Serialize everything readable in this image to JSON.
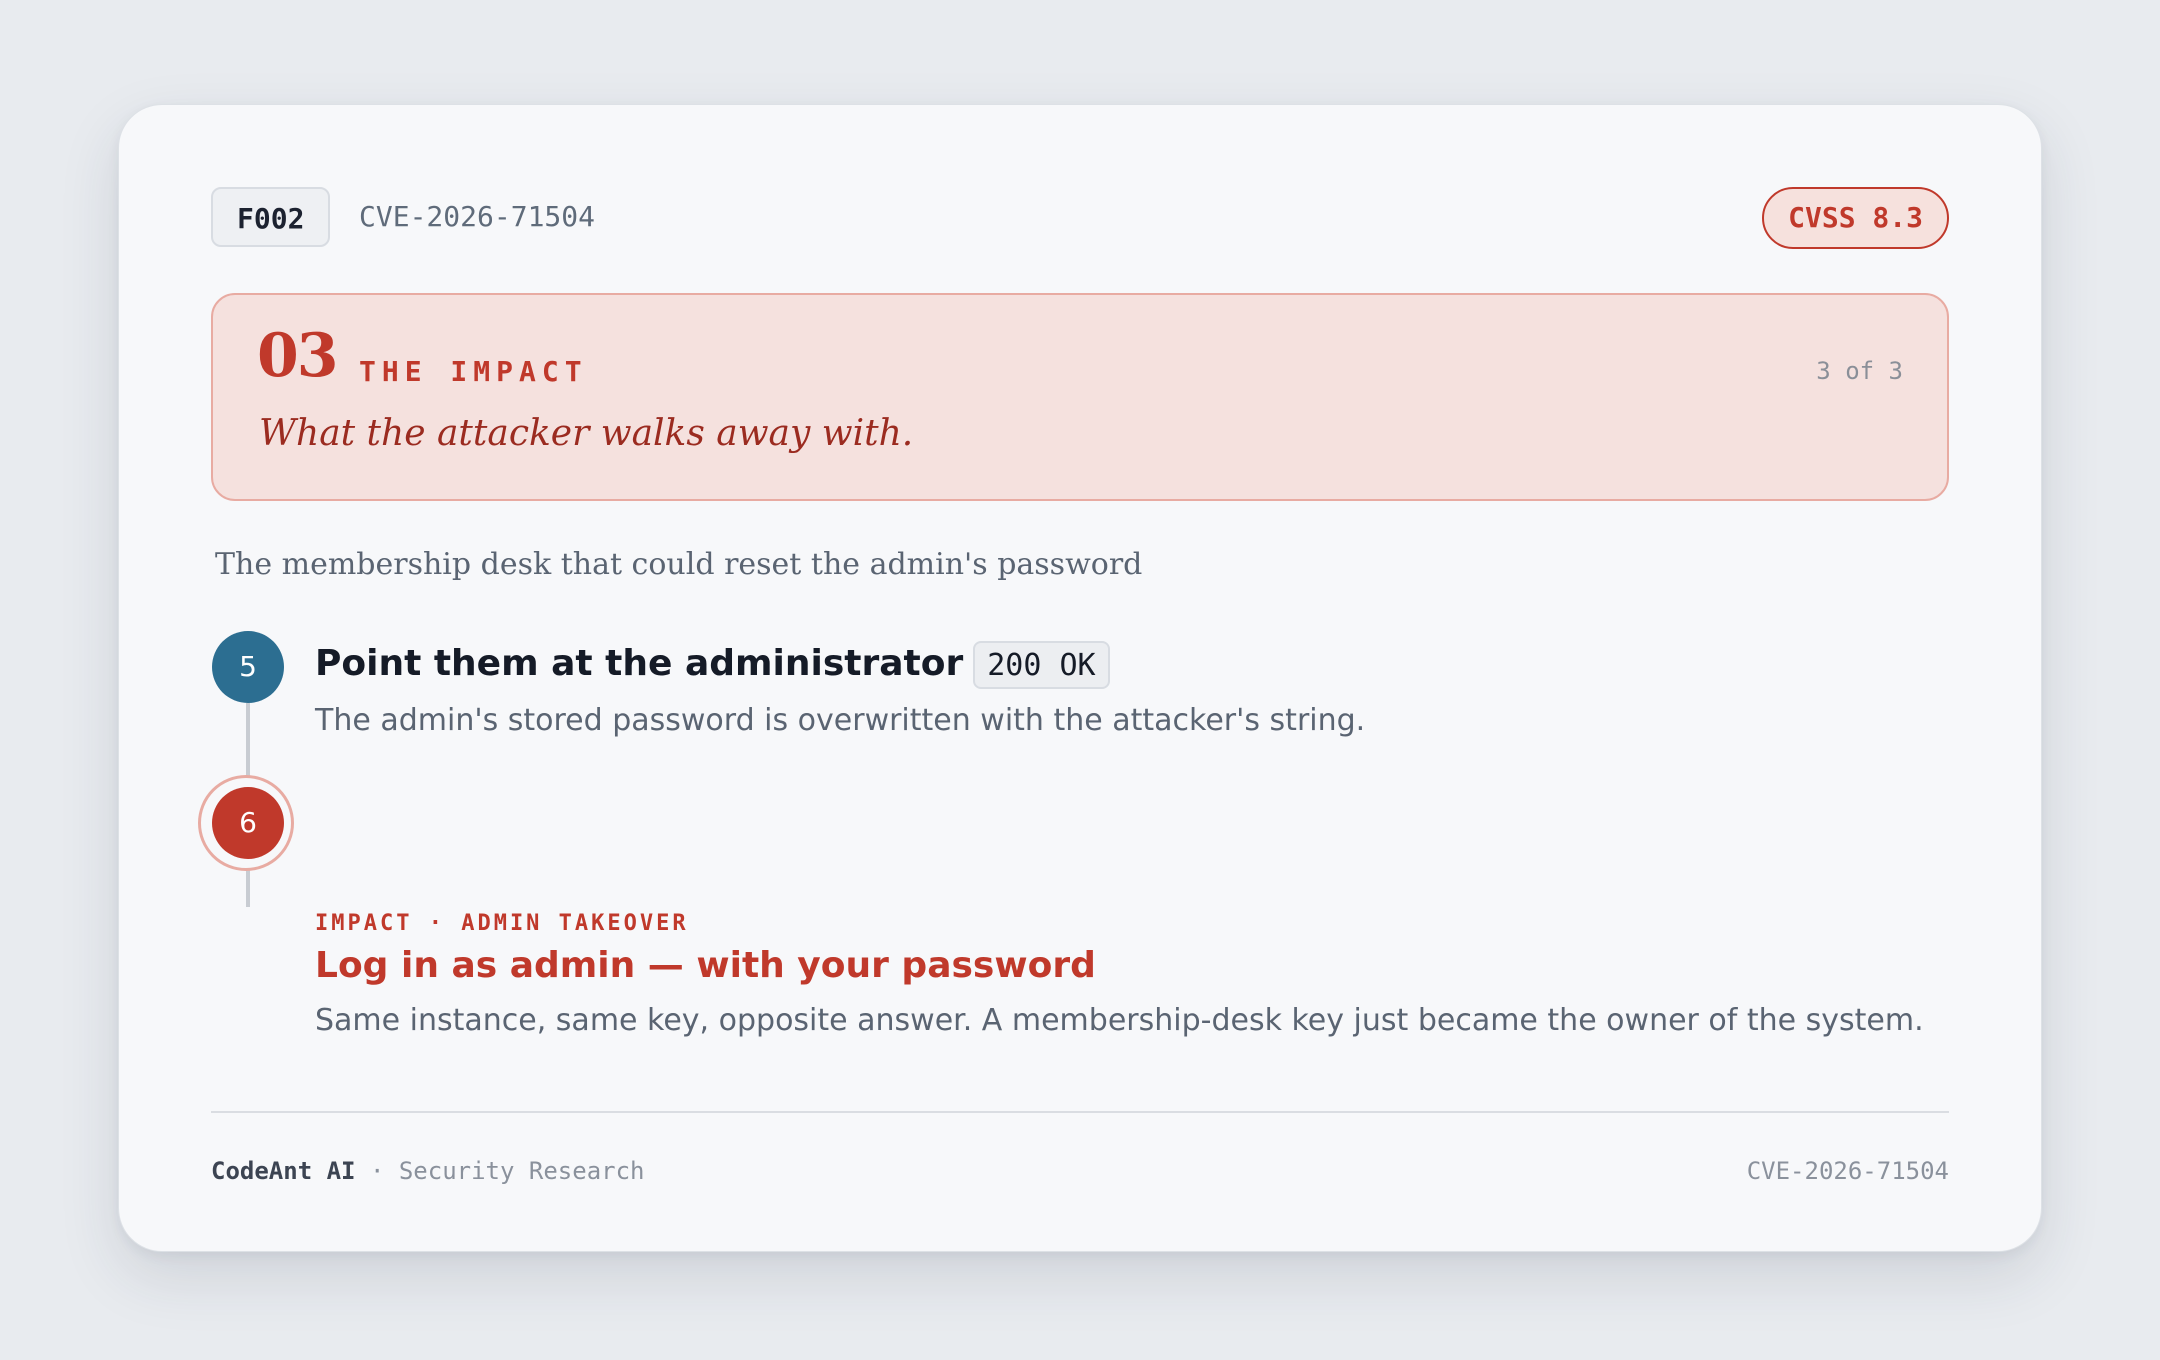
{
  "header": {
    "finding_id": "F002",
    "cve": "CVE-2026-71504",
    "cvss": "CVSS 8.3"
  },
  "stage": {
    "number": "03",
    "label": "THE IMPACT",
    "count": "3 of 3",
    "tagline": "What the attacker walks away with."
  },
  "story": {
    "title": "The membership desk that could reset the admin's password"
  },
  "steps": [
    {
      "number": "5",
      "title": "Point them at the administrator",
      "status": "200 OK",
      "description": "The admin's stored password is overwritten with the attacker's string."
    },
    {
      "number": "6",
      "eyebrow": "IMPACT · ADMIN TAKEOVER",
      "title": "Log in as admin — with your password",
      "description": "Same instance, same key, opposite answer. A membership-desk key just became the owner of the system."
    }
  ],
  "footer": {
    "brand": "CodeAnt AI",
    "separator": "·",
    "section": "Security Research",
    "cve": "CVE-2026-71504"
  },
  "colors": {
    "accent": "#c0392b",
    "step_blue": "#2c6e91",
    "stage_bg": "#f5e1de"
  }
}
